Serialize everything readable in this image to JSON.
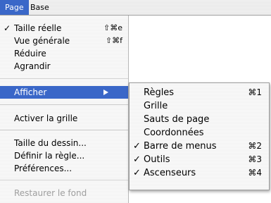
{
  "menubar": {
    "items": [
      "Page",
      "Base"
    ]
  },
  "page_menu": {
    "items": [
      {
        "label": "Taille réelle",
        "check": "✓",
        "shortcut": "⇧⌘e"
      },
      {
        "label": "Vue générale",
        "shortcut": "⇧⌘f"
      },
      {
        "label": "Réduire"
      },
      {
        "label": "Agrandir"
      },
      {
        "label": "Afficher"
      },
      {
        "label": "Activer la grille"
      },
      {
        "label": "Taille du dessin..."
      },
      {
        "label": "Définir la règle..."
      },
      {
        "label": "Préférences..."
      },
      {
        "label": "Restaurer le fond"
      }
    ]
  },
  "afficher_submenu": {
    "items": [
      {
        "label": "Règles",
        "shortcut": "⌘1"
      },
      {
        "label": "Grille"
      },
      {
        "label": "Sauts de page"
      },
      {
        "label": "Coordonnées"
      },
      {
        "label": "Barre de menus",
        "check": "✓",
        "shortcut": "⌘2"
      },
      {
        "label": "Outils",
        "check": "✓",
        "shortcut": "⌘3"
      },
      {
        "label": "Ascenseurs",
        "check": "✓",
        "shortcut": "⌘4"
      }
    ]
  },
  "colors": {
    "highlight": "#3a67c8",
    "disabled_text": "#9e9e9e"
  }
}
